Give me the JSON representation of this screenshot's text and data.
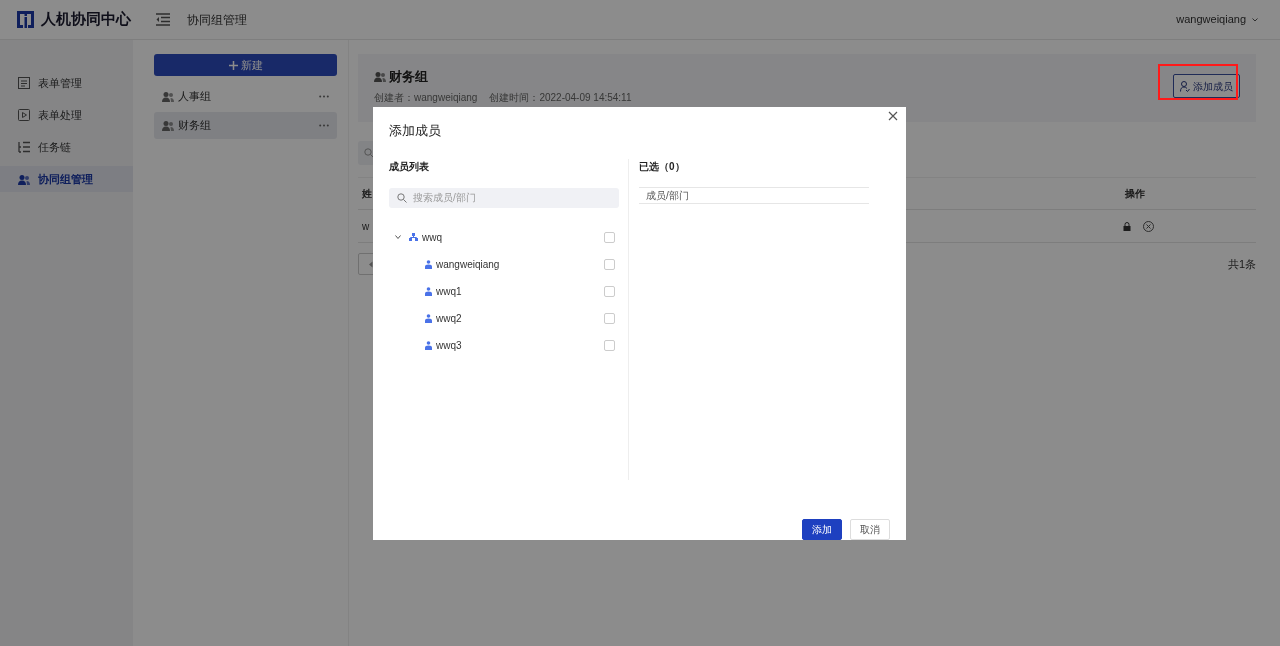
{
  "brand": {
    "title": "人机协同中心"
  },
  "header": {
    "page_title": "协同组管理",
    "user": "wangweiqiang"
  },
  "sidebar": {
    "items": [
      {
        "label": "表单管理",
        "kind": "form",
        "selected": false
      },
      {
        "label": "表单处理",
        "kind": "process",
        "selected": false
      },
      {
        "label": "任务链",
        "kind": "chain",
        "selected": false
      },
      {
        "label": "协同组管理",
        "kind": "group",
        "selected": true
      }
    ]
  },
  "groups": {
    "new_button": "新建",
    "items": [
      {
        "label": "人事组",
        "selected": false
      },
      {
        "label": "财务组",
        "selected": true
      }
    ]
  },
  "detail": {
    "title": "财务组",
    "creator": "创建者：wangweiqiang",
    "created": "创建时间：2022-04-09 14:54:11",
    "add_member_button": {
      "label": "添加成员",
      "highlighted": true
    }
  },
  "table": {
    "columns": [
      "姓",
      "操作"
    ],
    "rows": [
      {
        "cells": [
          "w"
        ]
      }
    ],
    "total": "共1条"
  },
  "dialog": {
    "title": "添加成员",
    "left_heading": "成员列表",
    "search": {
      "placeholder": "搜索成员/部门"
    },
    "tree": [
      {
        "label": "wwq",
        "kind": "department",
        "expanded": true,
        "checked": false,
        "children": [
          {
            "label": "wangweiqiang",
            "kind": "member",
            "checked": false
          },
          {
            "label": "wwq1",
            "kind": "member",
            "checked": false
          },
          {
            "label": "wwq2",
            "kind": "member",
            "checked": false
          },
          {
            "label": "wwq3",
            "kind": "member",
            "checked": false
          }
        ]
      }
    ],
    "right_heading": "已选（0）",
    "selected_column": "成员/部门",
    "buttons": [
      {
        "label": "添加",
        "kind": "primary"
      },
      {
        "label": "取消",
        "kind": "secondary"
      }
    ]
  }
}
